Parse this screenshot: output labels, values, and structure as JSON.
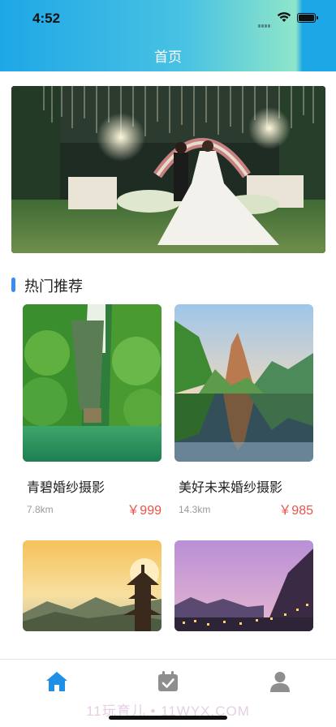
{
  "status_bar": {
    "time": "4:52"
  },
  "header": {
    "title": "首页"
  },
  "section": {
    "title": "热门推荐"
  },
  "cards": [
    {
      "name": "青碧婚纱摄影",
      "distance": "7.8km",
      "price": "￥999"
    },
    {
      "name": "美好未来婚纱摄影",
      "distance": "14.3km",
      "price": "￥985"
    },
    {
      "name": "",
      "distance": "",
      "price": ""
    },
    {
      "name": "",
      "distance": "",
      "price": ""
    }
  ],
  "tabbar": {
    "items": [
      {
        "icon": "home-icon",
        "active": true,
        "color": "#1e90e8"
      },
      {
        "icon": "calendar-check-icon",
        "active": false,
        "color": "#8e8e8e"
      },
      {
        "icon": "user-icon",
        "active": false,
        "color": "#8e8e8e"
      }
    ]
  },
  "watermark": "11玩育儿 • 11WYX.COM",
  "colors": {
    "accent": "#1e90e8",
    "price": "#e8534a",
    "section_bar": "#3b8cf0"
  }
}
